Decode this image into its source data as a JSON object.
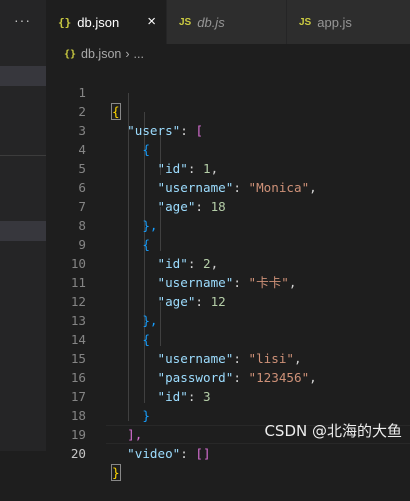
{
  "sidebar": {
    "more_icon": "···"
  },
  "tabs": [
    {
      "icon": "{}",
      "label": "db.json",
      "close": "×"
    },
    {
      "icon": "JS",
      "label": "db.js"
    },
    {
      "icon": "JS",
      "label": "app.js"
    }
  ],
  "breadcrumb": {
    "icon": "{}",
    "file": "db.json",
    "sep": "›",
    "tail": "..."
  },
  "line_numbers": [
    "1",
    "2",
    "3",
    "4",
    "5",
    "6",
    "7",
    "8",
    "9",
    "10",
    "11",
    "12",
    "13",
    "14",
    "15",
    "16",
    "17",
    "18",
    "19",
    "20"
  ],
  "code": {
    "l1_brace": "{",
    "users_key": "\"users\"",
    "colon": ":",
    "users_open": "[",
    "obj_open": "{",
    "obj_close": "},",
    "obj_close_last": "}",
    "users_close": "],",
    "l20_brace": "}",
    "u1": {
      "id_key": "\"id\"",
      "id_val": "1",
      "username_key": "\"username\"",
      "username_val": "\"Monica\"",
      "age_key": "\"age\"",
      "age_val": "18"
    },
    "u2": {
      "id_key": "\"id\"",
      "id_val": "2",
      "username_key": "\"username\"",
      "username_val": "\"卡卡\"",
      "age_key": "\"age\"",
      "age_val": "12"
    },
    "u3": {
      "username_key": "\"username\"",
      "username_val": "\"lisi\"",
      "password_key": "\"password\"",
      "password_val": "\"123456\"",
      "id_key": "\"id\"",
      "id_val": "3"
    },
    "video_key": "\"video\"",
    "video_val": "[]"
  },
  "watermark": "CSDN @北海的大鱼"
}
